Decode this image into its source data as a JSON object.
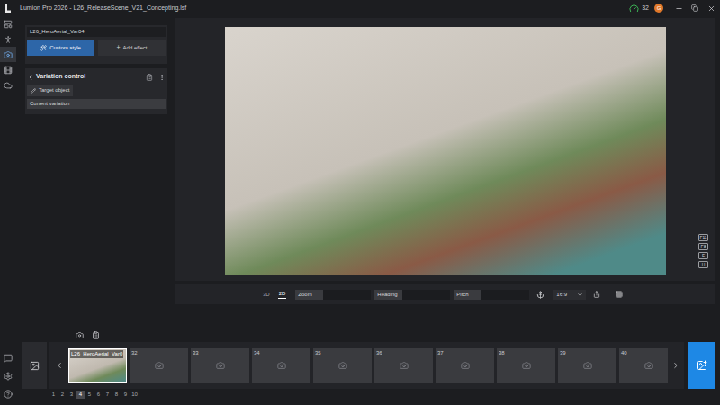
{
  "window": {
    "title": "Lumion Pro 2026 - L26_ReleaseScene_V21_Concepting.lsf",
    "counter": "32",
    "avatar": "G"
  },
  "rail": {
    "top": [
      {
        "kind": "layout",
        "selected": false
      },
      {
        "kind": "person",
        "selected": false
      },
      {
        "kind": "camera",
        "selected": true
      },
      {
        "kind": "movie",
        "selected": false
      },
      {
        "kind": "export",
        "selected": false
      }
    ],
    "bottom": [
      {
        "kind": "chat",
        "selected": false
      },
      {
        "kind": "settings",
        "selected": false
      },
      {
        "kind": "help",
        "selected": false
      }
    ]
  },
  "style_panel": {
    "name_field": "L26_HeroAerial_Var04",
    "buttons": [
      {
        "label": "Custom style",
        "icon": "",
        "selected": true
      },
      {
        "label": "Add effect",
        "icon": "+",
        "selected": false
      }
    ]
  },
  "variation_control": {
    "title": "Variation control",
    "target_button": "Target object",
    "current": "Current variation"
  },
  "viewport": {
    "shortcuts": [
      "F11",
      "F8",
      "F",
      "U"
    ]
  },
  "view_controls": {
    "modes": [
      {
        "label": "3D",
        "selected": false
      },
      {
        "label": "2D",
        "selected": true
      }
    ],
    "fields": [
      "Zoom",
      "Heading",
      "Pitch"
    ],
    "aspect": "16:9"
  },
  "thumbnails": [
    {
      "number": "",
      "label": "L26_HeroAerial_Var0",
      "kind": "image",
      "selected": true
    },
    {
      "number": "32",
      "label": "",
      "kind": "empty",
      "selected": false
    },
    {
      "number": "33",
      "label": "",
      "kind": "empty",
      "selected": false
    },
    {
      "number": "34",
      "label": "",
      "kind": "empty",
      "selected": false
    },
    {
      "number": "35",
      "label": "",
      "kind": "empty",
      "selected": false
    },
    {
      "number": "36",
      "label": "",
      "kind": "empty",
      "selected": false
    },
    {
      "number": "37",
      "label": "",
      "kind": "empty",
      "selected": false
    },
    {
      "number": "38",
      "label": "",
      "kind": "empty",
      "selected": false
    },
    {
      "number": "39",
      "label": "",
      "kind": "empty",
      "selected": false
    },
    {
      "number": "40",
      "label": "",
      "kind": "empty",
      "selected": false
    }
  ],
  "pages": [
    {
      "label": "1",
      "selected": false
    },
    {
      "label": "2",
      "selected": false
    },
    {
      "label": "3",
      "selected": false
    },
    {
      "label": "4",
      "selected": true
    },
    {
      "label": "5",
      "selected": false
    },
    {
      "label": "6",
      "selected": false
    },
    {
      "label": "7",
      "selected": false
    },
    {
      "label": "8",
      "selected": false
    },
    {
      "label": "9",
      "selected": false
    },
    {
      "label": "10",
      "selected": false
    }
  ]
}
